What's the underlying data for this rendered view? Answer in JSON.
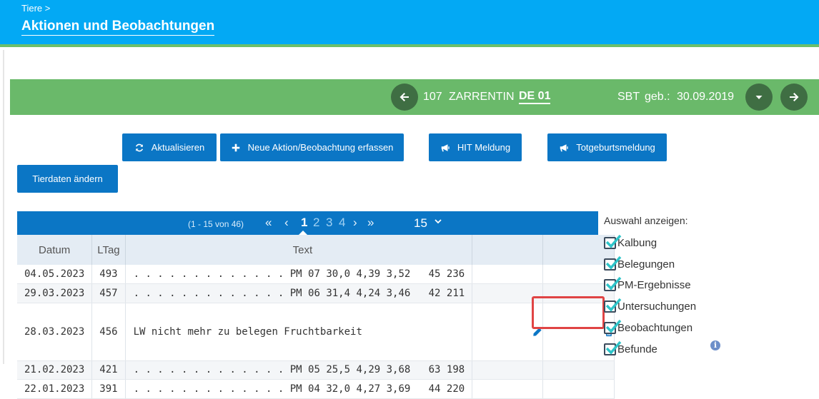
{
  "header": {
    "breadcrumb": "Tiere >",
    "title": "Aktionen und Beobachtungen"
  },
  "animal": {
    "number": "107",
    "name": "ZARRENTIN",
    "ohrmarke": "DE 01",
    "breed": "SBT",
    "born_label": "geb.:",
    "born_date": "30.09.2019"
  },
  "actions": {
    "refresh": "Aktualisieren",
    "new_action": "Neue Aktion/Beobachtung erfassen",
    "hit": "HIT Meldung",
    "stillbirth": "Totgeburtsmeldung",
    "edit_animal": "Tierdaten ändern"
  },
  "pager": {
    "range": "(1 - 15 von 46)",
    "pages": [
      "1",
      "2",
      "3",
      "4"
    ],
    "active_page": "1",
    "page_size": "15"
  },
  "table": {
    "headers": {
      "date": "Datum",
      "ltag": "LTag",
      "text": "Text"
    },
    "rows": [
      {
        "date": "04.05.2023",
        "ltag": "493",
        "text": ". . . . . . . . . . . . . PM 07 30,0 4,39 3,52   45 236"
      },
      {
        "date": "29.03.2023",
        "ltag": "457",
        "text": ". . . . . . . . . . . . . PM 06 31,4 4,24 3,46   42 211"
      },
      {
        "date": "28.03.2023",
        "ltag": "456",
        "text": "LW nicht mehr zu belegen Fruchtbarkeit"
      },
      {
        "date": "21.02.2023",
        "ltag": "421",
        "text": ". . . . . . . . . . . . . PM 05 25,5 4,29 3,68   63 198"
      },
      {
        "date": "22.01.2023",
        "ltag": "391",
        "text": ". . . . . . . . . . . . . PM 04 32,0 4,27 3,69   44 220"
      }
    ]
  },
  "filter": {
    "title": "Auswahl anzeigen:",
    "items": [
      "Kalbung",
      "Belegungen",
      "PM-Ergebnisse",
      "Untersuchungen",
      "Beobachtungen",
      "Befunde"
    ]
  },
  "colors": {
    "header_blue": "#03a9f4",
    "button_blue": "#0b76c5",
    "animal_green": "#6ab96a",
    "highlight_red": "#e04444"
  }
}
